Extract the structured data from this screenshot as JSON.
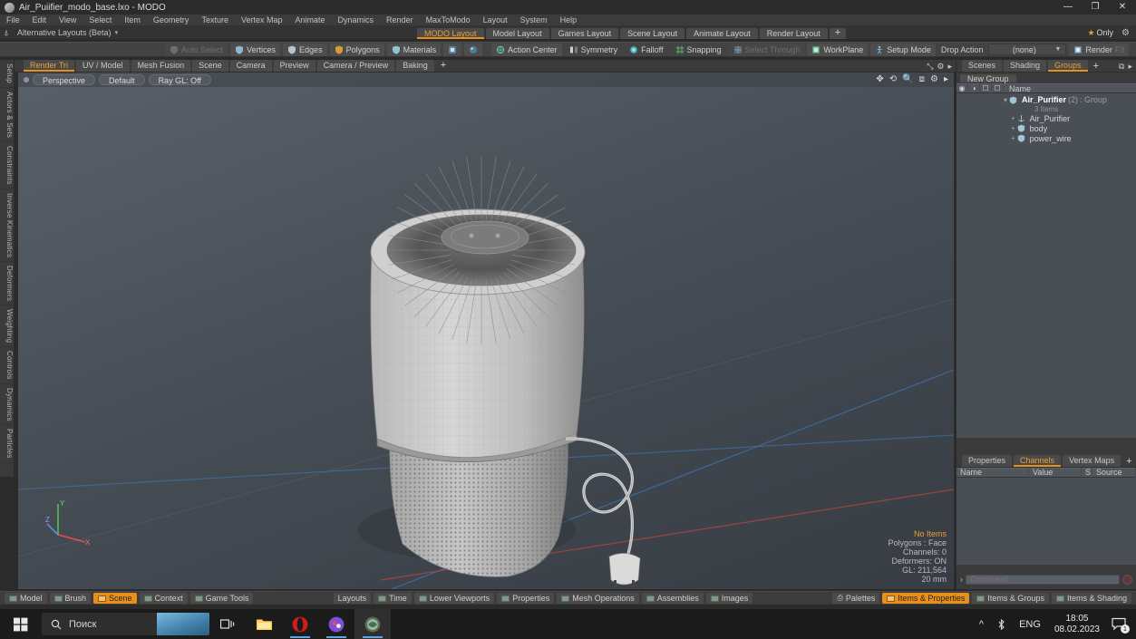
{
  "window": {
    "title": "Air_Puiifier_modo_base.lxo - MODO",
    "minimize": "—",
    "maximize": "❐",
    "close": "✕"
  },
  "menu": {
    "items": [
      "File",
      "Edit",
      "View",
      "Select",
      "Item",
      "Geometry",
      "Texture",
      "Vertex Map",
      "Animate",
      "Dynamics",
      "Render",
      "MaxToModo",
      "Layout",
      "System",
      "Help"
    ]
  },
  "layout_bar": {
    "alt_layouts": "Alternative Layouts (Beta)",
    "caret": "▾",
    "star": "★",
    "only": "Only",
    "gear": "⚙"
  },
  "layout_tabs": {
    "items": [
      {
        "label": "MODO Layout",
        "active": true
      },
      {
        "label": "Model Layout",
        "active": false
      },
      {
        "label": "Games Layout",
        "active": false
      },
      {
        "label": "Scene Layout",
        "active": false
      },
      {
        "label": "Animate Layout",
        "active": false
      },
      {
        "label": "Render Layout",
        "active": false
      }
    ],
    "add": "+"
  },
  "toolbar": {
    "auto_select": "Auto Select",
    "vertices": "Vertices",
    "edges": "Edges",
    "polygons": "Polygons",
    "materials": "Materials",
    "action_center": "Action Center",
    "symmetry": "Symmetry",
    "falloff": "Falloff",
    "snapping": "Snapping",
    "select_through": "Select Through",
    "workplane": "WorkPlane",
    "setup_mode": "Setup Mode",
    "drop_action": "Drop Action",
    "drop_action_value": "(none)",
    "render": "Render",
    "render_key": "F9"
  },
  "left_tabs": {
    "items": [
      "Setup",
      "Actors & Sets",
      "Constraints",
      "Inverse Kinematics",
      "Deformers",
      "Weighting",
      "Controls",
      "Dynamics",
      "Particles"
    ]
  },
  "viewport_tabs": {
    "items": [
      {
        "label": "Render Tri",
        "active": true
      },
      {
        "label": "UV / Model",
        "active": false
      },
      {
        "label": "Mesh Fusion",
        "active": false
      },
      {
        "label": "Scene",
        "active": false
      },
      {
        "label": "Camera",
        "active": false
      },
      {
        "label": "Preview",
        "active": false
      },
      {
        "label": "Camera / Preview",
        "active": false
      },
      {
        "label": "Baking",
        "active": false
      }
    ],
    "add": "+",
    "expand_icon": "⤡",
    "more_icon": "▸"
  },
  "viewport": {
    "projection": "Perspective",
    "shading": "Default",
    "raygl": "Ray GL: Off",
    "header_icons": [
      "move-icon",
      "rotate-icon",
      "zoom-icon",
      "fit-icon",
      "gear-icon",
      "more-icon"
    ],
    "stats": {
      "no_items": "No Items",
      "polygons": "Polygons : Face",
      "channels": "Channels: 0",
      "deformers": "Deformers: ON",
      "gl": "GL: 211,564",
      "units": "20 mm"
    },
    "axis": {
      "x": "X",
      "y": "Y",
      "z": "Z"
    }
  },
  "right_panel": {
    "tabs": [
      {
        "label": "Scenes",
        "active": false
      },
      {
        "label": "Shading",
        "active": false
      },
      {
        "label": "Groups",
        "active": true
      }
    ],
    "add": "+",
    "new_group": "New Group",
    "columns": [
      "◉",
      "◑",
      "■",
      "■"
    ],
    "name_header": "Name",
    "tree": [
      {
        "name": "Air_Purifier",
        "count": "(2)",
        "type": ": Group",
        "sub": "3 Items",
        "level": 0,
        "bold": true,
        "icon": "group-icon"
      },
      {
        "name": "Air_Purifier",
        "level": 1,
        "bold": false,
        "icon": "locator-icon"
      },
      {
        "name": "body",
        "level": 1,
        "bold": false,
        "icon": "mesh-icon"
      },
      {
        "name": "power_wire",
        "level": 1,
        "bold": false,
        "icon": "mesh-icon"
      }
    ]
  },
  "lower_right": {
    "tabs": [
      {
        "label": "Properties",
        "active": false
      },
      {
        "label": "Channels",
        "active": true
      },
      {
        "label": "Vertex Maps",
        "active": false
      }
    ],
    "add": "+",
    "columns": [
      "Name",
      "Value",
      "S",
      "Source"
    ]
  },
  "command_bar": {
    "caret": "›",
    "placeholder": "Command"
  },
  "status_bar": {
    "left": [
      {
        "label": "Model",
        "active": false
      },
      {
        "label": "Brush",
        "active": false
      },
      {
        "label": "Scene",
        "active": true
      },
      {
        "label": "Context",
        "active": false
      },
      {
        "label": "Game Tools",
        "active": false
      }
    ],
    "center": [
      {
        "label": "Layouts",
        "active": false,
        "noicon": true
      },
      {
        "label": "Time",
        "active": false
      },
      {
        "label": "Lower Viewports",
        "active": false
      },
      {
        "label": "Properties",
        "active": false
      },
      {
        "label": "Mesh Operations",
        "active": false
      },
      {
        "label": "Assemblies",
        "active": false
      },
      {
        "label": "Images",
        "active": false
      }
    ],
    "right": [
      {
        "label": "Palettes",
        "active": false
      },
      {
        "label": "Items & Properties",
        "active": true
      },
      {
        "label": "Items & Groups",
        "active": false
      },
      {
        "label": "Items & Shading",
        "active": false
      }
    ]
  },
  "taskbar": {
    "start": "start-icon",
    "search_placeholder": "Поиск",
    "task_view": "task-view-icon",
    "apps": [
      "file-explorer-icon",
      "opera-icon",
      "opera-gx-icon",
      "modo-icon"
    ],
    "tray_chevron": "^",
    "tray_bluetooth": "bluetooth-icon",
    "language": "ENG",
    "time": "18:05",
    "date": "08.02.2023",
    "notification_count": "1"
  }
}
